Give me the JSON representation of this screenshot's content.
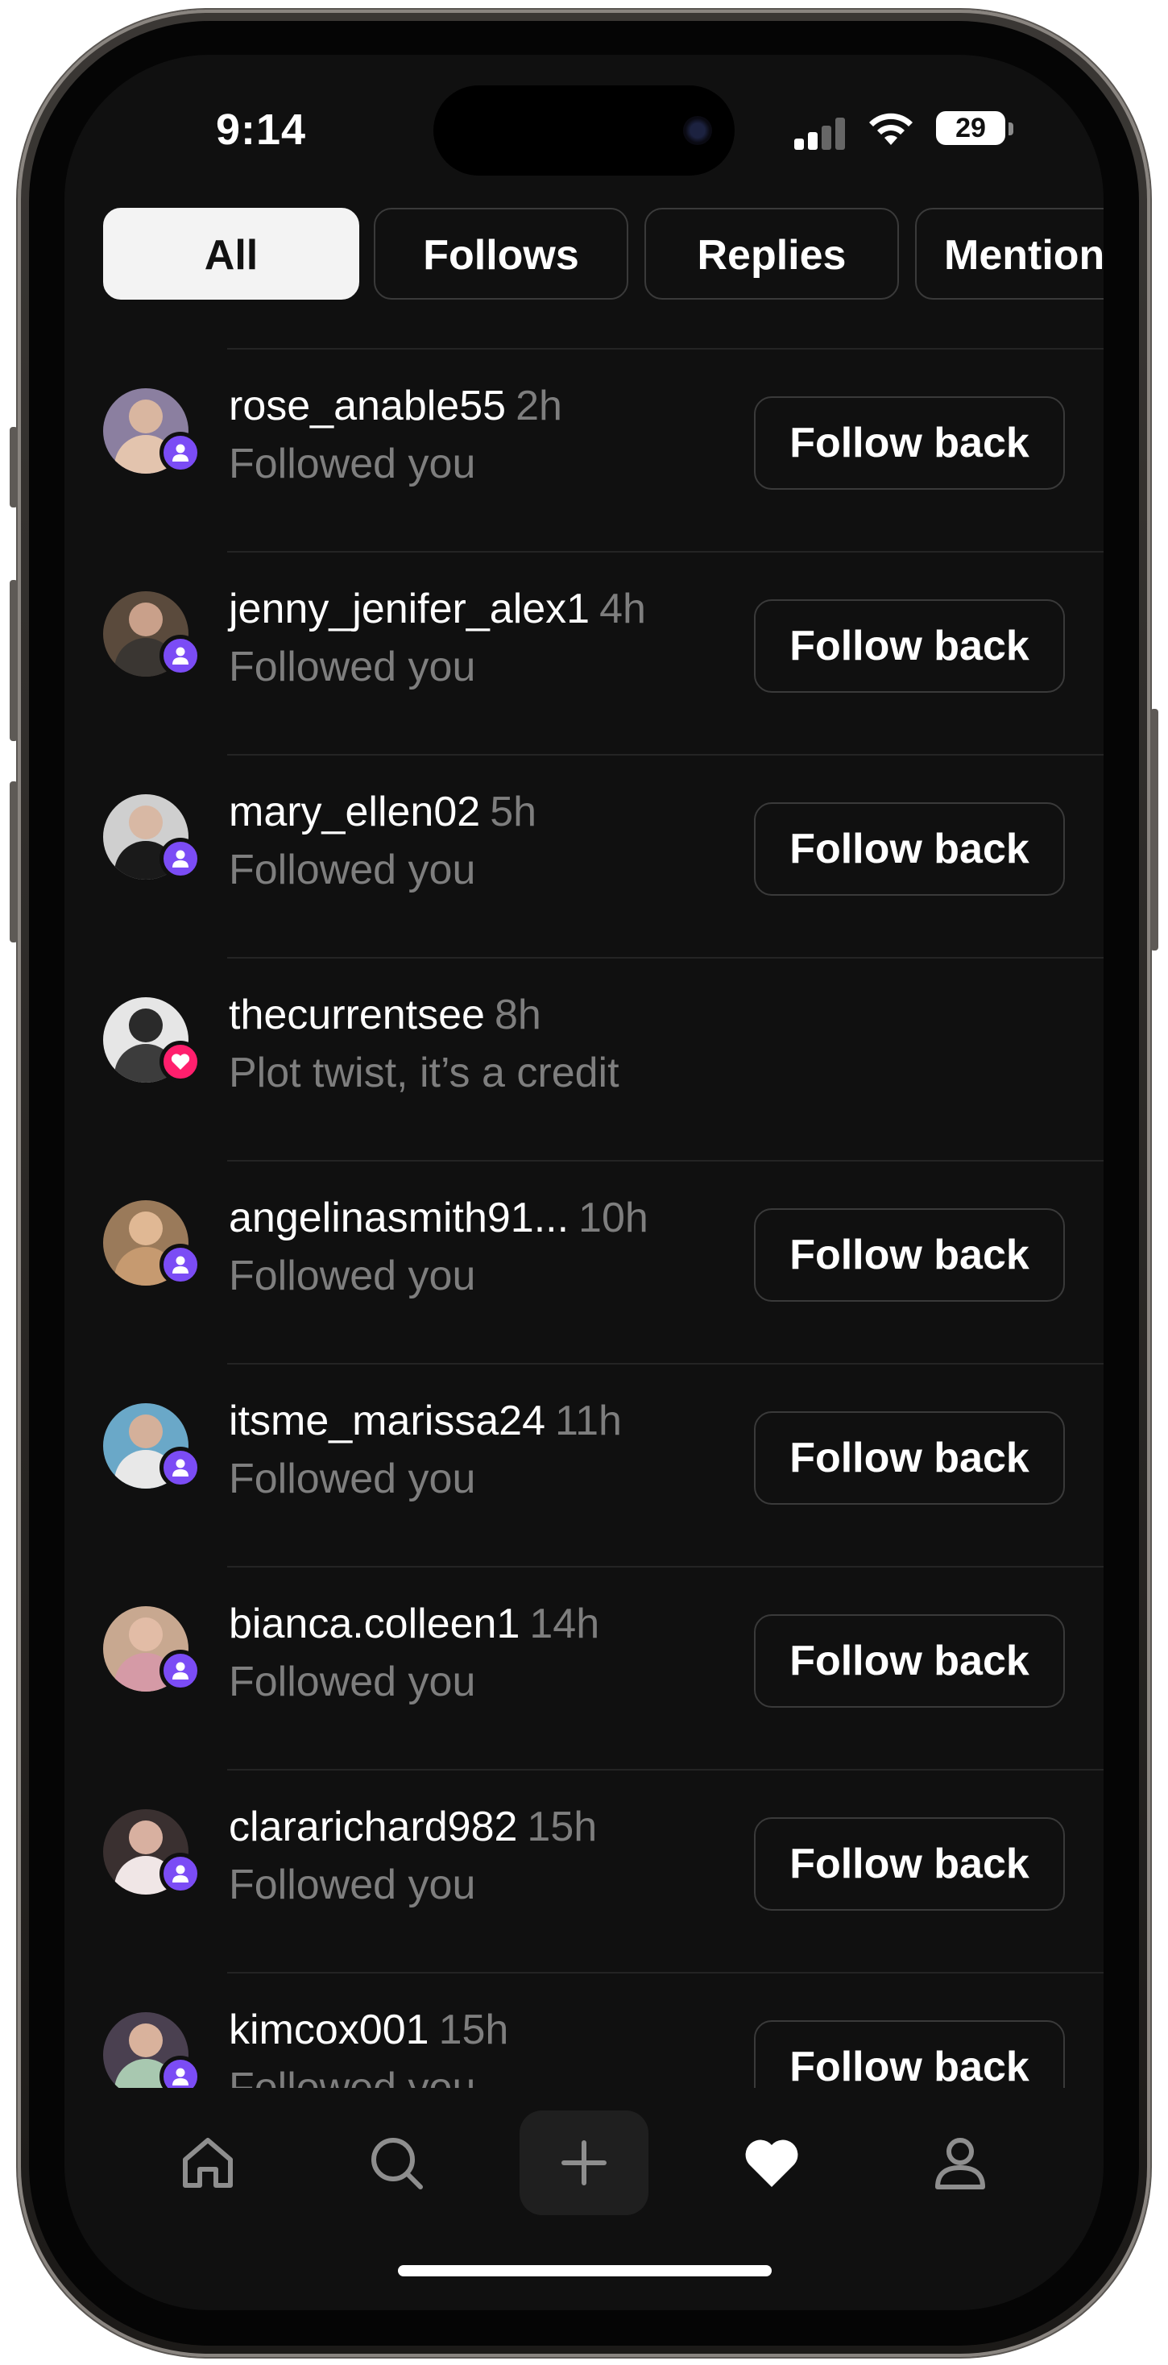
{
  "status_bar": {
    "time": "9:14",
    "battery": "29"
  },
  "tabs": [
    {
      "label": "All",
      "active": true
    },
    {
      "label": "Follows",
      "active": false
    },
    {
      "label": "Replies",
      "active": false
    },
    {
      "label": "Mentions",
      "active": false
    }
  ],
  "activity": [
    {
      "username": "rose_anable55",
      "time": "2h",
      "subtitle": "Followed you",
      "action": "Follow back",
      "badge": "person-icon"
    },
    {
      "username": "jenny_jenifer_alex1",
      "time": "4h",
      "subtitle": "Followed you",
      "action": "Follow back",
      "badge": "person-icon"
    },
    {
      "username": "mary_ellen02",
      "time": "5h",
      "subtitle": "Followed you",
      "action": "Follow back",
      "badge": "person-icon"
    },
    {
      "username": "thecurrentsee",
      "time": "8h",
      "subtitle": "Plot twist, it’s a credit",
      "action": "",
      "badge": "heart-icon"
    },
    {
      "username": "angelinasmith91...",
      "time": "10h",
      "subtitle": "Followed you",
      "action": "Follow back",
      "badge": "person-icon"
    },
    {
      "username": "itsme_marissa24",
      "time": "11h",
      "subtitle": "Followed you",
      "action": "Follow back",
      "badge": "person-icon"
    },
    {
      "username": "bianca.colleen1",
      "time": "14h",
      "subtitle": "Followed you",
      "action": "Follow back",
      "badge": "person-icon"
    },
    {
      "username": "clararichard982",
      "time": "15h",
      "subtitle": "Followed you",
      "action": "Follow back",
      "badge": "person-icon"
    },
    {
      "username": "kimcox001",
      "time": "15h",
      "subtitle": "Followed you",
      "action": "Follow back",
      "badge": "person-icon"
    }
  ],
  "nav": [
    {
      "icon": "home-icon"
    },
    {
      "icon": "search-icon"
    },
    {
      "icon": "plus-icon"
    },
    {
      "icon": "heart-icon"
    },
    {
      "icon": "profile-icon"
    }
  ],
  "colors": {
    "follow_badge": "#7b4cf5",
    "like_badge": "#ff1f6d",
    "background": "#101010"
  }
}
